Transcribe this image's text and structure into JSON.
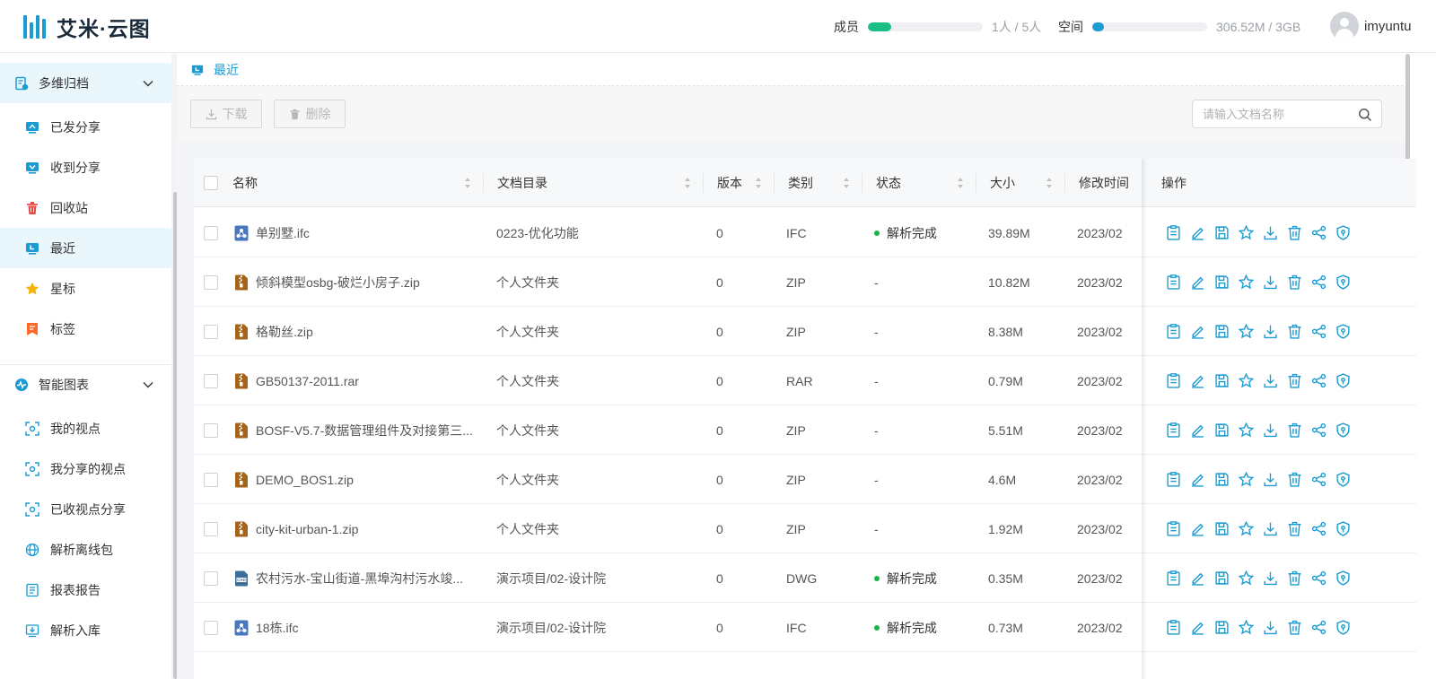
{
  "app": {
    "logo_text": "艾米·云图"
  },
  "header": {
    "members": {
      "label": "成员",
      "text": "1人 / 5人",
      "fill_percent": 20,
      "color": "#1bbf83"
    },
    "space": {
      "label": "空间",
      "text": "306.52M / 3GB",
      "fill_percent": 10,
      "color": "#1b9bd1"
    },
    "username": "imyuntu"
  },
  "sidebar": {
    "group1": {
      "label": "多维归档",
      "icon": "archive-icon"
    },
    "items1": [
      {
        "label": "已发分享",
        "icon": "share-out-icon",
        "color": "#1b9bd1"
      },
      {
        "label": "收到分享",
        "icon": "share-in-icon",
        "color": "#1b9bd1"
      },
      {
        "label": "回收站",
        "icon": "trash-icon",
        "color": "#e84a4a"
      },
      {
        "label": "最近",
        "icon": "recent-icon",
        "color": "#1b9bd1",
        "active": true
      },
      {
        "label": "星标",
        "icon": "star-icon",
        "color": "#f5b400"
      },
      {
        "label": "标签",
        "icon": "tag-icon",
        "color": "#ff6a2b"
      }
    ],
    "group2": {
      "label": "智能图表",
      "icon": "chart-icon"
    },
    "items2": [
      {
        "label": "我的视点",
        "icon": "viewpoint-icon"
      },
      {
        "label": "我分享的视点",
        "icon": "viewpoint-share-icon"
      },
      {
        "label": "已收视点分享",
        "icon": "viewpoint-received-icon"
      },
      {
        "label": "解析离线包",
        "icon": "globe-icon"
      },
      {
        "label": "报表报告",
        "icon": "report-icon"
      },
      {
        "label": "解析入库",
        "icon": "import-icon"
      }
    ]
  },
  "breadcrumb": {
    "label": "最近"
  },
  "toolbar": {
    "download_label": "下载",
    "delete_label": "删除",
    "search_placeholder": "请输入文档名称"
  },
  "table": {
    "columns": {
      "name": "名称",
      "dir": "文档目录",
      "version": "版本",
      "type": "类别",
      "status": "状态",
      "size": "大小",
      "modified": "修改时间",
      "ops": "操作"
    },
    "rows": [
      {
        "name": "单别墅.ifc",
        "icon": "ifc-icon",
        "dir": "0223-优化功能",
        "version": "0",
        "type": "IFC",
        "status": "解析完成",
        "parsed": true,
        "size": "39.89M",
        "modified": "2023/02"
      },
      {
        "name": "倾斜模型osbg-破烂小房子.zip",
        "icon": "zip-icon",
        "dir": "个人文件夹",
        "version": "0",
        "type": "ZIP",
        "status": "-",
        "parsed": false,
        "size": "10.82M",
        "modified": "2023/02"
      },
      {
        "name": "格勒丝.zip",
        "icon": "zip-icon",
        "dir": "个人文件夹",
        "version": "0",
        "type": "ZIP",
        "status": "-",
        "parsed": false,
        "size": "8.38M",
        "modified": "2023/02"
      },
      {
        "name": "GB50137-2011.rar",
        "icon": "zip-icon",
        "dir": "个人文件夹",
        "version": "0",
        "type": "RAR",
        "status": "-",
        "parsed": false,
        "size": "0.79M",
        "modified": "2023/02"
      },
      {
        "name": "BOSF-V5.7-数据管理组件及对接第三...",
        "icon": "zip-icon",
        "dir": "个人文件夹",
        "version": "0",
        "type": "ZIP",
        "status": "-",
        "parsed": false,
        "size": "5.51M",
        "modified": "2023/02"
      },
      {
        "name": "DEMO_BOS1.zip",
        "icon": "zip-icon",
        "dir": "个人文件夹",
        "version": "0",
        "type": "ZIP",
        "status": "-",
        "parsed": false,
        "size": "4.6M",
        "modified": "2023/02"
      },
      {
        "name": "city-kit-urban-1.zip",
        "icon": "zip-icon",
        "dir": "个人文件夹",
        "version": "0",
        "type": "ZIP",
        "status": "-",
        "parsed": false,
        "size": "1.92M",
        "modified": "2023/02"
      },
      {
        "name": "农村污水-宝山街道-黑埠沟村污水竣...",
        "icon": "cad-icon",
        "dir": "演示项目/02-设计院",
        "version": "0",
        "type": "DWG",
        "status": "解析完成",
        "parsed": true,
        "size": "0.35M",
        "modified": "2023/02"
      },
      {
        "name": "18栋.ifc",
        "icon": "ifc-icon",
        "dir": "演示项目/02-设计院",
        "version": "0",
        "type": "IFC",
        "status": "解析完成",
        "parsed": true,
        "size": "0.73M",
        "modified": "2023/02"
      }
    ],
    "row_actions": [
      "details-icon",
      "edit-icon",
      "save-icon",
      "star-icon",
      "download-icon",
      "delete-icon",
      "share-icon",
      "permission-icon"
    ]
  },
  "theme": {
    "accent": "#1b9bd1",
    "parsed_dot": "#18b547",
    "zip_icon": "#a5641b",
    "ifc_icon": "#4a76c0",
    "cad_icon": "#3c6e9a"
  }
}
